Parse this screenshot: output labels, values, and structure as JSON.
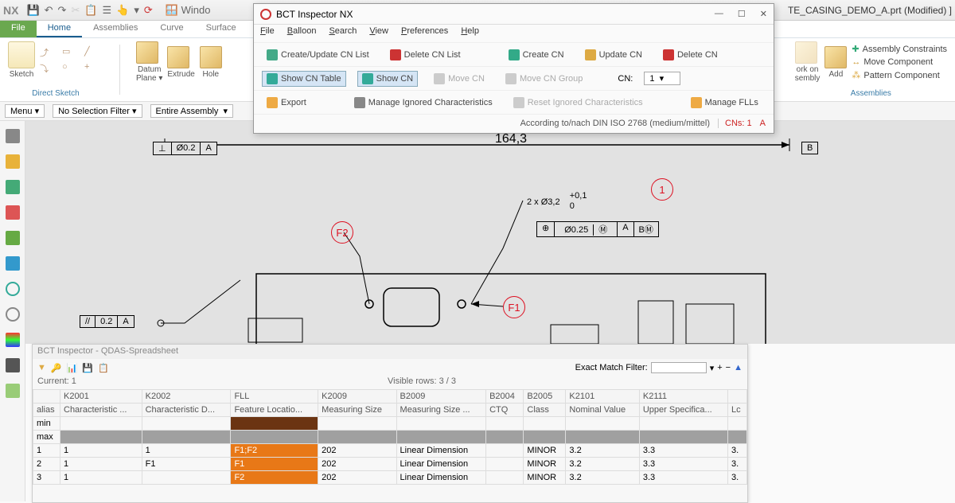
{
  "nx": {
    "logo": "NX",
    "title_right": "TE_CASING_DEMO_A.prt (Modified) ]",
    "window_btn": "Windo",
    "tabs": {
      "file": "File",
      "home": "Home",
      "assemblies": "Assemblies",
      "curve": "Curve",
      "surface": "Surface"
    },
    "ribbon": {
      "sketch": "Sketch",
      "direct_sketch": "Direct Sketch",
      "datum": "Datum\nPlane ▾",
      "extrude": "Extrude",
      "hole": "Hole",
      "work_on": "ork on\nsembly",
      "add": "Add",
      "asm_constraints": "Assembly Constraints",
      "move_comp": "Move Component",
      "pattern_comp": "Pattern Component",
      "assemblies_group": "Assemblies"
    },
    "toolbar2": {
      "menu": "Menu ▾",
      "filter": "No Selection Filter ▾",
      "scope": "Entire Assembly"
    }
  },
  "dlg": {
    "title": "BCT Inspector NX",
    "menu": {
      "file": "File",
      "balloon": "Balloon",
      "search": "Search",
      "view": "View",
      "prefs": "Preferences",
      "help": "Help"
    },
    "row1": {
      "create_list": "Create/Update CN List",
      "delete_list": "Delete CN List",
      "create_cn": "Create CN",
      "update_cn": "Update CN",
      "delete_cn": "Delete CN"
    },
    "row2": {
      "show_table": "Show CN Table",
      "show_cn": "Show CN",
      "move_cn": "Move CN",
      "move_group": "Move CN Group",
      "cn_label": "CN:",
      "cn_value": "1"
    },
    "row3": {
      "export": "Export",
      "manage_ign": "Manage Ignored Characteristics",
      "reset_ign": "Reset Ignored Characteristics",
      "manage_fll": "Manage FLLs"
    },
    "status": {
      "std": "According to/nach DIN ISO 2768 (medium/mittel)",
      "cns": "CNs: 1",
      "a": "A"
    }
  },
  "draw": {
    "dim164": "164,3",
    "perp": "⊥",
    "perp_tol": "Ø0.2",
    "perp_datum": "A",
    "par": "//",
    "par_tol": "0.2",
    "par_datum": "A",
    "hole": "2 x  Ø3,2",
    "tol_up": "+0,1",
    "tol_lo": "0",
    "pos": "⊕",
    "pos_tol": "Ø0.25",
    "pos_m": "Ⓜ",
    "pos_a": "A",
    "pos_b": "BⓂ",
    "datum_b": "B",
    "f1": "F1",
    "f2": "F2",
    "b1": "1"
  },
  "sp": {
    "title": "BCT Inspector - QDAS-Spreadsheet",
    "filter_label": "Exact Match Filter:",
    "current": "Current: 1",
    "visible": "Visible rows: 3 / 3",
    "hdrgrp": [
      "",
      "K2001",
      "K2002",
      "FLL",
      "K2009",
      "B2009",
      "B2004",
      "B2005",
      "K2101",
      "K2111",
      ""
    ],
    "hdr": [
      "alias",
      "Characteristic ...",
      "Characteristic D...",
      "Feature Locatio...",
      "Measuring Size",
      "Measuring Size ...",
      "CTQ",
      "Class",
      "Nominal Value",
      "Upper Specifica...",
      "Lc"
    ],
    "rows": [
      {
        "alias": "1",
        "c1": "1",
        "c2": "1",
        "fll": "F1;F2",
        "ms": "202",
        "msd": "Linear Dimension",
        "ctq": "",
        "cls": "MINOR",
        "nom": "3.2",
        "usl": "3.3",
        "lc": "3."
      },
      {
        "alias": "2",
        "c1": "1",
        "c2": "F1",
        "fll": "F1",
        "ms": "202",
        "msd": "Linear Dimension",
        "ctq": "",
        "cls": "MINOR",
        "nom": "3.2",
        "usl": "3.3",
        "lc": "3."
      },
      {
        "alias": "3",
        "c1": "1",
        "c2": "",
        "fll": "F2",
        "ms": "202",
        "msd": "Linear Dimension",
        "ctq": "",
        "cls": "MINOR",
        "nom": "3.2",
        "usl": "3.3",
        "lc": "3."
      }
    ]
  }
}
